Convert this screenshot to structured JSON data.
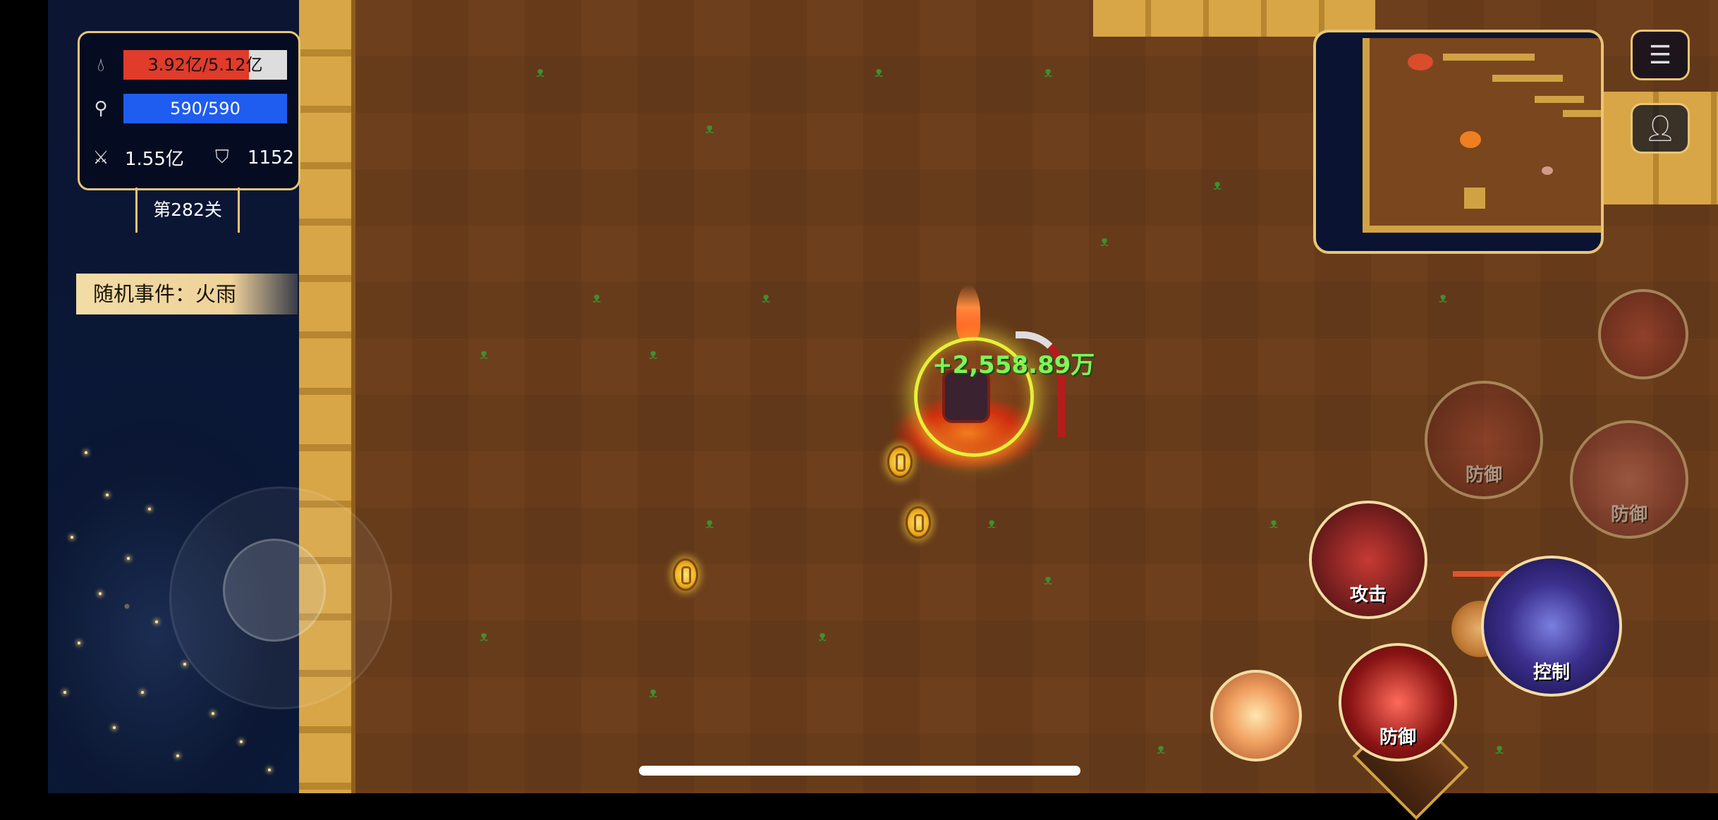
{
  "hud": {
    "hp": {
      "icon": "drop-icon",
      "text": "3.92亿/5.12亿",
      "fill_fraction": 0.766,
      "color": "#e03b2b"
    },
    "mp": {
      "icon": "magnifier-icon",
      "text": "590/590",
      "fill_fraction": 1.0,
      "color": "#1f5cf0"
    },
    "attack": {
      "icon": "sword-icon",
      "value": "1.55亿"
    },
    "defense": {
      "icon": "shield-icon",
      "value": "1152"
    },
    "stage": "第282关",
    "event": "随机事件：火雨"
  },
  "combat": {
    "damage_popup": "+2,558.89万",
    "coins": 3
  },
  "buttons": {
    "menu_icon": "menu-icon",
    "profile_icon": "person-icon"
  },
  "skills": {
    "attack": "攻击",
    "control": "控制",
    "defense_main": "防御",
    "defense_faded_1": "防御",
    "defense_faded_2": "防御"
  },
  "colors": {
    "panel_border": "#e8c576",
    "ground": "#6d3f1c",
    "wall": "#d8a646",
    "damage_text": "#7bf55a"
  }
}
